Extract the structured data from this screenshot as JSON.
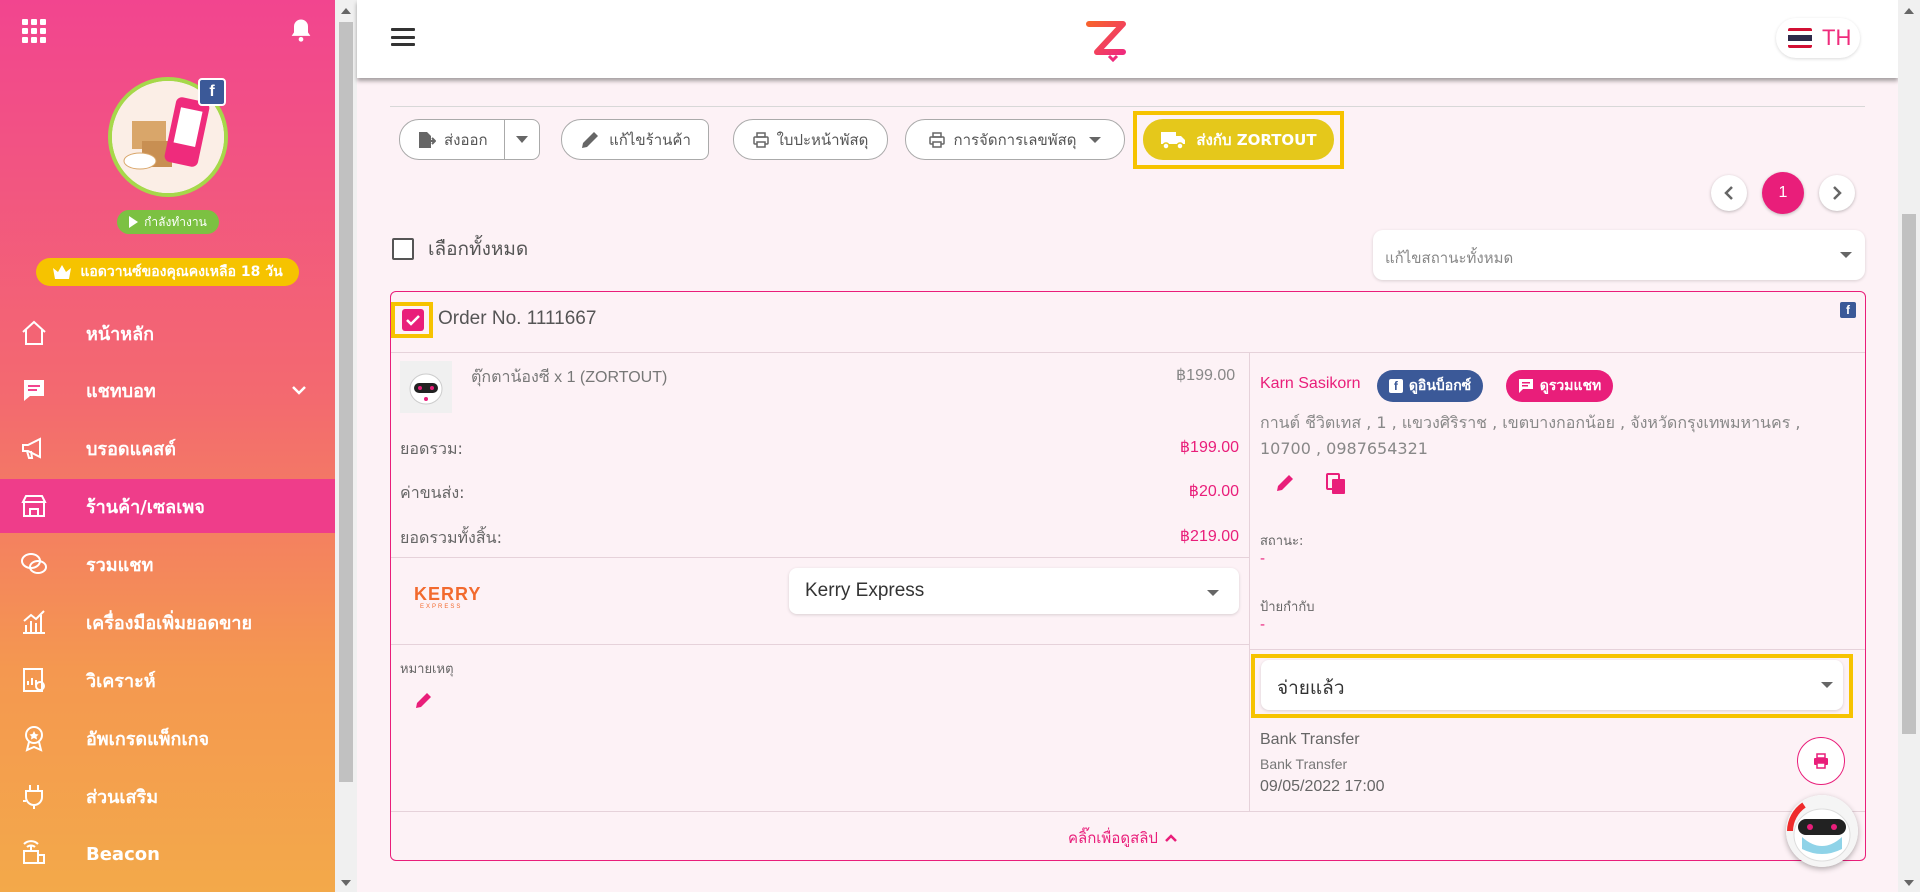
{
  "sidebar": {
    "status_label": "กำลังทำงาน",
    "trial_label": "แอดวานซ์ของคุณคงเหลือ 18 วัน",
    "nav": [
      {
        "label": "หน้าหลัก",
        "icon": "home-icon"
      },
      {
        "label": "แชทบอท",
        "icon": "chat-icon"
      },
      {
        "label": "บรอดแคสต์",
        "icon": "megaphone-icon"
      },
      {
        "label": "ร้านค้า/เซลเพจ",
        "icon": "shop-icon"
      },
      {
        "label": "รวมแชท",
        "icon": "chats-icon"
      },
      {
        "label": "เครื่องมือเพิ่มยอดขาย",
        "icon": "sales-chart-icon"
      },
      {
        "label": "วิเคราะห์",
        "icon": "analytics-icon"
      },
      {
        "label": "อัพเกรดแพ็กเกจ",
        "icon": "medal-icon"
      },
      {
        "label": "ส่วนเสริม",
        "icon": "plugin-icon"
      },
      {
        "label": "Beacon",
        "icon": "beacon-icon"
      }
    ],
    "active_index": 3
  },
  "header": {
    "lang": "TH"
  },
  "toolbar": {
    "export_label": "ส่งออก",
    "edit_shop_label": "แก้ไขร้านค้า",
    "cover_label": "ใบปะหน้าพัสดุ",
    "tracking_label": "การจัดการเลขพัสดุ",
    "zortout_label": "ส่งกับ ZORTOUT"
  },
  "pagination": {
    "current": "1"
  },
  "select_all_label": "เลือกทั้งหมด",
  "status_all_placeholder": "แก้ไขสถานะทั้งหมด",
  "order": {
    "number": "Order No. 1111667",
    "product_name": "ตุ๊กตาน้องซี x 1 (ZORTOUT)",
    "product_price": "฿199.00",
    "subtotal_label": "ยอดรวม:",
    "subtotal": "฿199.00",
    "shipping_label": "ค่าขนส่ง:",
    "shipping": "฿20.00",
    "total_label": "ยอดรวมทั้งสิ้น:",
    "total": "฿219.00",
    "courier": "Kerry Express",
    "note_label": "หมายเหตุ",
    "customer_name": "Karn Sasikorn",
    "inbox_label": "ดูอินบ็อกซ์",
    "chat_label": "ดูรวมแชท",
    "address": "กานต์ ชีวิตเทส , 1 , แขวงศิริราช , เขตบางกอกน้อย , จังหวัดกรุงเทพมหานคร , 10700 , 0987654321",
    "status_label": "สถานะ:",
    "status_value": "-",
    "tag_label": "ป้ายกำกับ",
    "tag_value": "-",
    "payment_status": "จ่ายแล้ว",
    "payment_method": "Bank Transfer",
    "payment_method_sub": "Bank Transfer",
    "payment_date": "09/05/2022 17:00",
    "slip_link": "คลิ๊กเพื่อดูสลิป"
  },
  "colors": {
    "accent": "#e91e7a",
    "highlight": "#f6c300",
    "facebook": "#3b5998"
  }
}
